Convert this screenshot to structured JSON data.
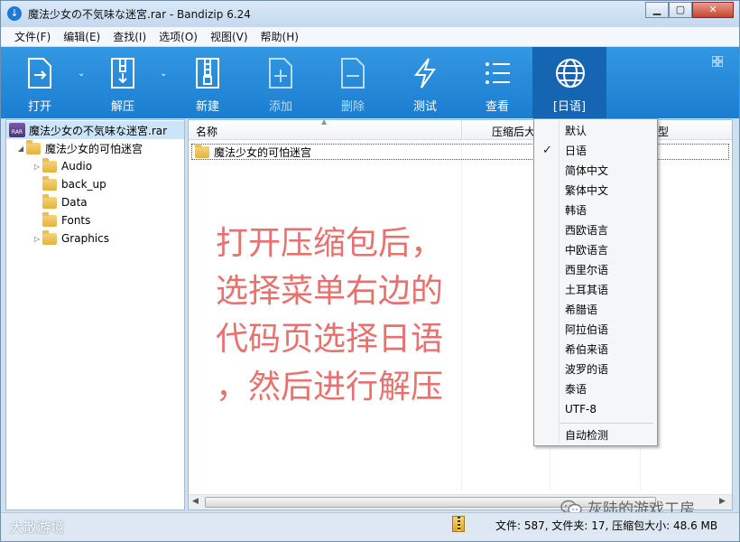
{
  "window": {
    "title": "魔法少女の不気味な迷宮.rar - Bandizip 6.24",
    "minimize": "▁",
    "maximize": "▢",
    "close": "✕"
  },
  "menu": [
    "文件(F)",
    "编辑(E)",
    "查找(I)",
    "选项(O)",
    "视图(V)",
    "帮助(H)"
  ],
  "toolbar": {
    "open": "打开",
    "extract": "解压",
    "new": "新建",
    "add": "添加",
    "delete": "删除",
    "test": "测试",
    "view": "查看",
    "codepage": "[日语]"
  },
  "tree": {
    "root": "魔法少女の不気味な迷宮.rar",
    "folder": "魔法少女的可怕迷宫",
    "children": [
      "Audio",
      "back_up",
      "Data",
      "Fonts",
      "Graphics"
    ]
  },
  "columns": {
    "name": "名称",
    "compressed": "压缩后大",
    "type": "型"
  },
  "file_row": "魔法少女的可怕迷宫",
  "annotation": [
    "打开压缩包后，",
    "选择菜单右边的",
    "代码页选择日语",
    "，然后进行解压"
  ],
  "dropdown": {
    "items": [
      "默认",
      "日语",
      "简体中文",
      "繁体中文",
      "韩语",
      "西欧语言",
      "中欧语言",
      "西里尔语",
      "土耳其语",
      "希腊语",
      "阿拉伯语",
      "希伯来语",
      "波罗的语",
      "泰语",
      "UTF-8"
    ],
    "auto_detect": "自动检测",
    "checked": "日语",
    "check_mark": "✓"
  },
  "status": "文件: 587, 文件夹: 17, 压缩包大小: 48.6 MB",
  "watermarks": {
    "left": "大散游境",
    "right": "灰陆的游戏工房"
  },
  "icons": {
    "app": "bandizip-icon",
    "rar": "RAR"
  }
}
